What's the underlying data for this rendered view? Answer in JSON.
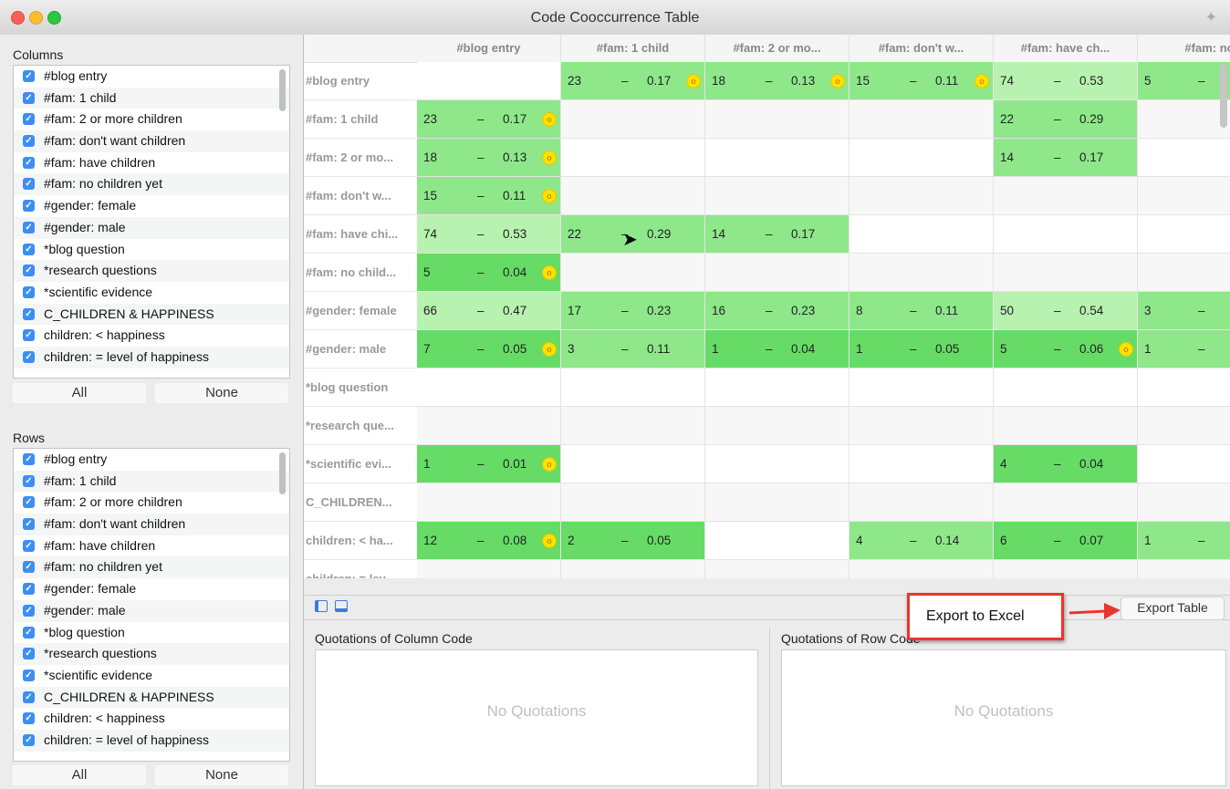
{
  "window": {
    "title": "Code Cooccurrence Table"
  },
  "columns_panel": {
    "title": "Columns",
    "items": [
      "#blog entry",
      "#fam: 1 child",
      "#fam: 2 or more  children",
      "#fam: don't want children",
      "#fam: have children",
      "#fam: no children yet",
      "#gender: female",
      "#gender: male",
      "*blog question",
      "*research questions",
      "*scientific evidence",
      "C_CHILDREN & HAPPINESS",
      "children: < happiness",
      "children: = level of happiness"
    ],
    "all_label": "All",
    "none_label": "None"
  },
  "rows_panel": {
    "title": "Rows",
    "items": [
      "#blog entry",
      "#fam: 1 child",
      "#fam: 2 or more  children",
      "#fam: don't want children",
      "#fam: have children",
      "#fam: no children yet",
      "#gender: female",
      "#gender: male",
      "*blog question",
      "*research questions",
      "*scientific evidence",
      "C_CHILDREN & HAPPINESS",
      "children: < happiness",
      "children: = level of happiness"
    ],
    "all_label": "All",
    "none_label": "None"
  },
  "table": {
    "column_headers": [
      "#blog entry",
      "#fam: 1 child",
      "#fam: 2 or mo...",
      "#fam: don't w...",
      "#fam: have ch...",
      "#fam: no"
    ],
    "row_labels": [
      "#blog entry",
      "#fam: 1 child",
      "#fam: 2 or mo...",
      "#fam: don't w...",
      "#fam: have chi...",
      "#fam: no child...",
      "#gender: female",
      "#gender: male",
      "*blog question",
      "*research que...",
      "*scientific evi...",
      "C_CHILDREN...",
      "children: < ha...",
      "children: = lev..."
    ],
    "cells": [
      [
        null,
        {
          "n": "23",
          "c": "0.17",
          "q": true
        },
        {
          "n": "18",
          "c": "0.13",
          "q": true
        },
        {
          "n": "15",
          "c": "0.11",
          "q": true
        },
        {
          "n": "74",
          "c": "0.53",
          "q": false
        },
        {
          "n": "5",
          "c": "",
          "q": false
        }
      ],
      [
        {
          "n": "23",
          "c": "0.17",
          "q": true
        },
        null,
        null,
        null,
        {
          "n": "22",
          "c": "0.29",
          "q": false
        },
        null
      ],
      [
        {
          "n": "18",
          "c": "0.13",
          "q": true
        },
        null,
        null,
        null,
        {
          "n": "14",
          "c": "0.17",
          "q": false
        },
        null
      ],
      [
        {
          "n": "15",
          "c": "0.11",
          "q": true
        },
        null,
        null,
        null,
        null,
        null
      ],
      [
        {
          "n": "74",
          "c": "0.53",
          "q": false
        },
        {
          "n": "22",
          "c": "0.29",
          "q": false
        },
        {
          "n": "14",
          "c": "0.17",
          "q": false
        },
        null,
        null,
        null
      ],
      [
        {
          "n": "5",
          "c": "0.04",
          "q": true
        },
        null,
        null,
        null,
        null,
        null
      ],
      [
        {
          "n": "66",
          "c": "0.47",
          "q": false
        },
        {
          "n": "17",
          "c": "0.23",
          "q": false
        },
        {
          "n": "16",
          "c": "0.23",
          "q": false
        },
        {
          "n": "8",
          "c": "0.11",
          "q": false
        },
        {
          "n": "50",
          "c": "0.54",
          "q": false
        },
        {
          "n": "3",
          "c": "",
          "q": false
        }
      ],
      [
        {
          "n": "7",
          "c": "0.05",
          "q": true
        },
        {
          "n": "3",
          "c": "0.11",
          "q": false
        },
        {
          "n": "1",
          "c": "0.04",
          "q": false
        },
        {
          "n": "1",
          "c": "0.05",
          "q": false
        },
        {
          "n": "5",
          "c": "0.06",
          "q": true
        },
        {
          "n": "1",
          "c": "",
          "q": false
        }
      ],
      [
        null,
        null,
        null,
        null,
        null,
        null
      ],
      [
        null,
        null,
        null,
        null,
        null,
        null
      ],
      [
        {
          "n": "1",
          "c": "0.01",
          "q": true
        },
        null,
        null,
        null,
        {
          "n": "4",
          "c": "0.04",
          "q": false
        },
        null
      ],
      [
        null,
        null,
        null,
        null,
        null,
        null
      ],
      [
        {
          "n": "12",
          "c": "0.08",
          "q": true
        },
        {
          "n": "2",
          "c": "0.05",
          "q": false
        },
        null,
        {
          "n": "4",
          "c": "0.14",
          "q": false
        },
        {
          "n": "6",
          "c": "0.07",
          "q": false
        },
        {
          "n": "1",
          "c": "",
          "q": false
        }
      ],
      [
        null,
        null,
        null,
        null,
        null,
        null
      ]
    ]
  },
  "bottom": {
    "column_quotes_title": "Quotations of Column Code",
    "row_quotes_title": "Quotations of Row Code",
    "no_quotations": "No Quotations",
    "export_button": "Export Table",
    "callout": "Export to Excel"
  },
  "colors": {
    "cell_green": "#8ee88a",
    "cell_light_green": "#b8f2b0",
    "cell_dark_green": "#66dc66",
    "callout_red": "#e9352c",
    "checkbox_blue": "#3d8ef3"
  }
}
